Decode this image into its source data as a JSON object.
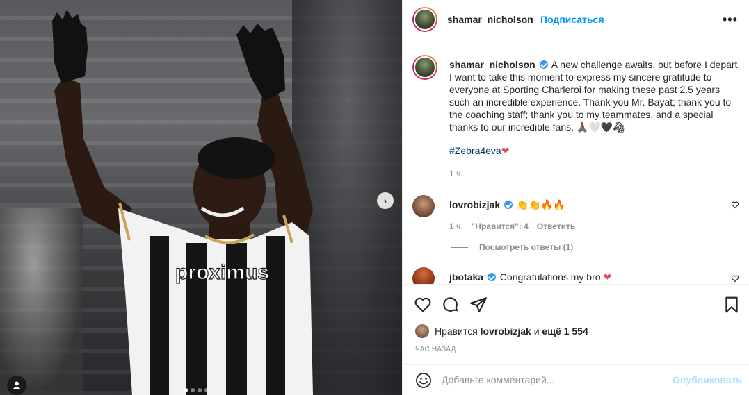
{
  "post": {
    "username": "shamar_nicholson",
    "follow_label": "Подписаться",
    "separator": "•",
    "more_label": "•••"
  },
  "media": {
    "next_arrow": "›",
    "slide_count": 4,
    "active_slide": 1
  },
  "caption": {
    "username": "shamar_nicholson",
    "text": "A new challenge awaits, but before I depart, I want to take this moment to express my sincere gratitude to everyone at Sporting Charleroi for making these past 2.5 years such an incredible experience. Thank you Mr. Bayat; thank you to the coaching staff; thank you to my teammates, and a special thanks to our incredible fans. 🙏🏾🤍🖤🦓",
    "hashtag": "#Zebra4eva",
    "hashtag_emoji": "❤",
    "time": "1 ч."
  },
  "comments": [
    {
      "username": "lovrobizjak",
      "text": "👏👏🔥🔥",
      "time": "1 ч.",
      "likes": "\"Нравится\": 4",
      "reply": "Ответить",
      "view_replies": "Посмотреть ответы (1)"
    },
    {
      "username": "jbotaka",
      "text": "Congratulations my bro",
      "emoji": "❤"
    }
  ],
  "likes": {
    "prefix": "Нравится",
    "user": "lovrobizjak",
    "middle": "и",
    "rest": "ещё 1 554"
  },
  "post_time": "ЧАС НАЗАД",
  "add_comment": {
    "placeholder": "Добавьте комментарий...",
    "publish_label": "Опубликовать"
  },
  "colors": {
    "accent": "#0095f6",
    "publish_disabled": "#b2dffc",
    "verified": "#3897f0",
    "heart": "#ed4956"
  },
  "icons": [
    "heart-icon",
    "comment-icon",
    "share-icon",
    "bookmark-icon",
    "emoji-icon",
    "user-tag-icon",
    "chevron-right-icon",
    "more-icon",
    "verified-icon"
  ]
}
